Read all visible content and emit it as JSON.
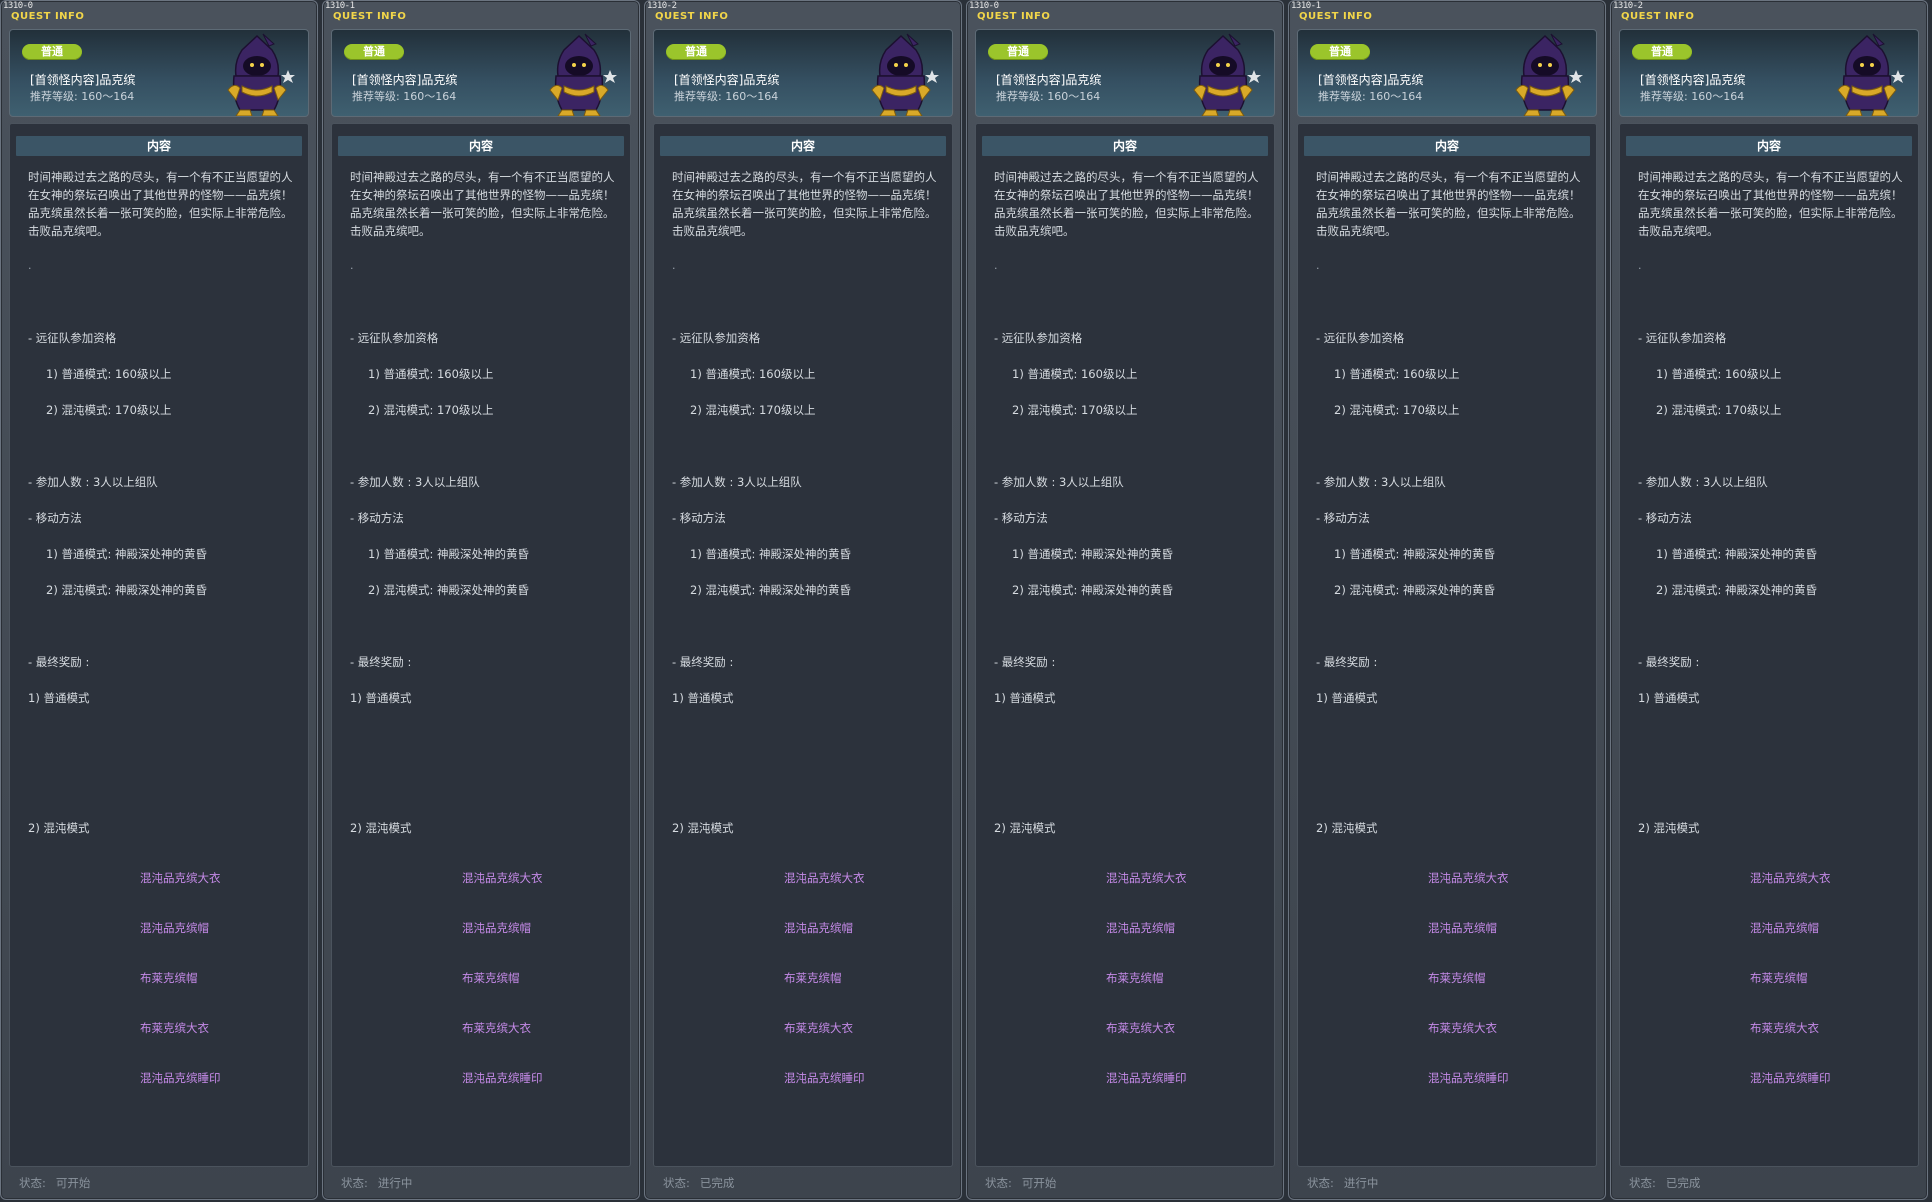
{
  "panels": [
    {
      "id": "1310-0",
      "title": "QUEST INFO",
      "status_value": "可开始"
    },
    {
      "id": "1310-1",
      "title": "QUEST INFO",
      "status_value": "进行中"
    },
    {
      "id": "1310-2",
      "title": "QUEST INFO",
      "status_value": "已完成"
    },
    {
      "id": "1310-0",
      "title": "QUEST INFO",
      "status_value": "可开始"
    },
    {
      "id": "1310-1",
      "title": "QUEST INFO",
      "status_value": "进行中"
    },
    {
      "id": "1310-2",
      "title": "QUEST INFO",
      "status_value": "已完成"
    }
  ],
  "quest": {
    "badge": "普通",
    "name": "[首领怪内容]品克缤",
    "rec_level": "推荐等级:  160～164",
    "content_header": "内容",
    "description": "时间神殿过去之路的尽头，有一个有不正当愿望的人在女神的祭坛召唤出了其他世界的怪物——品克缤！品克缤虽然长着一张可笑的脸，但实际上非常危险。击败品克缤吧。",
    "dot": ".",
    "qual_title": "- 远征队参加资格",
    "qual_normal": "1) 普通模式:  160级以上",
    "qual_chaos": "2) 混沌模式:  170级以上",
    "participants": "- 参加人数   :  3人以上组队",
    "move_title": "- 移动方法",
    "move_normal": "1) 普通模式:    神殿深处神的黄昏",
    "move_chaos": "2) 混沌模式:    神殿深处神的黄昏",
    "reward_title": "- 最终奖励   :",
    "reward_normal": "1) 普通模式",
    "reward_chaos": "2) 混沌模式",
    "rewards": [
      "混沌品克缤大衣",
      "混沌品克缤帽",
      "布莱克缤帽",
      "布莱克缤大衣",
      "混沌品克缤睡印"
    ],
    "status_label": "状态:"
  },
  "colors": {
    "title_yellow": "#f2d64a",
    "badge_green": "#9bc52b",
    "reward_purple": "#c58ae8",
    "content_header_bg": "#3b5566"
  }
}
